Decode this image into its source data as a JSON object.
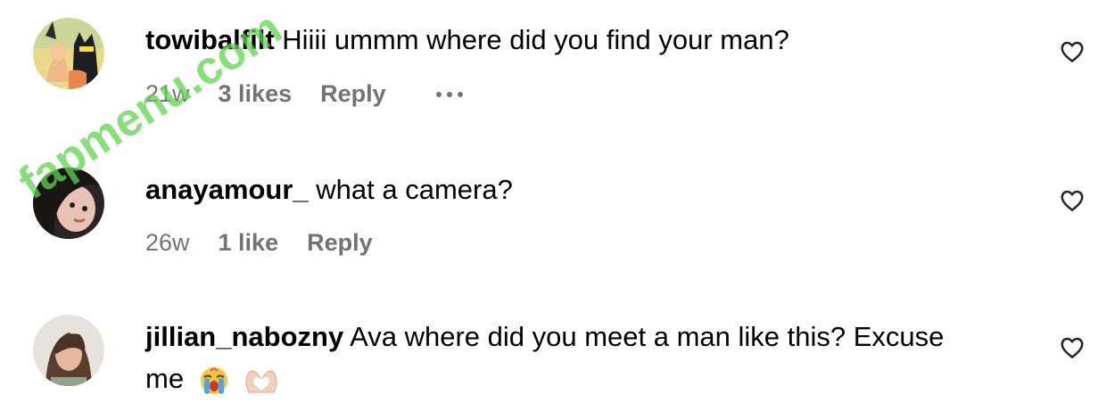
{
  "comments": [
    {
      "username": "towibalfilt",
      "text": "Hiiii ummm where did you find your man?",
      "time": "21w",
      "likes": "3 likes",
      "reply": "Reply"
    },
    {
      "username": "anayamour_",
      "text": "what a camera?",
      "time": "26w",
      "likes": "1 like",
      "reply": "Reply"
    },
    {
      "username": "jillian_nabozny",
      "text": "Ava where did you meet a man like this? Excuse",
      "text2": "me"
    }
  ],
  "watermark": "fapmenu.com",
  "icons": {
    "like": "heart-outline-icon",
    "more": "more-dots-icon",
    "emoji1": "loudly-crying-face-icon",
    "emoji2": "heart-hands-icon"
  },
  "colors": {
    "meta": "#737373",
    "watermark": "#5fd34f"
  }
}
